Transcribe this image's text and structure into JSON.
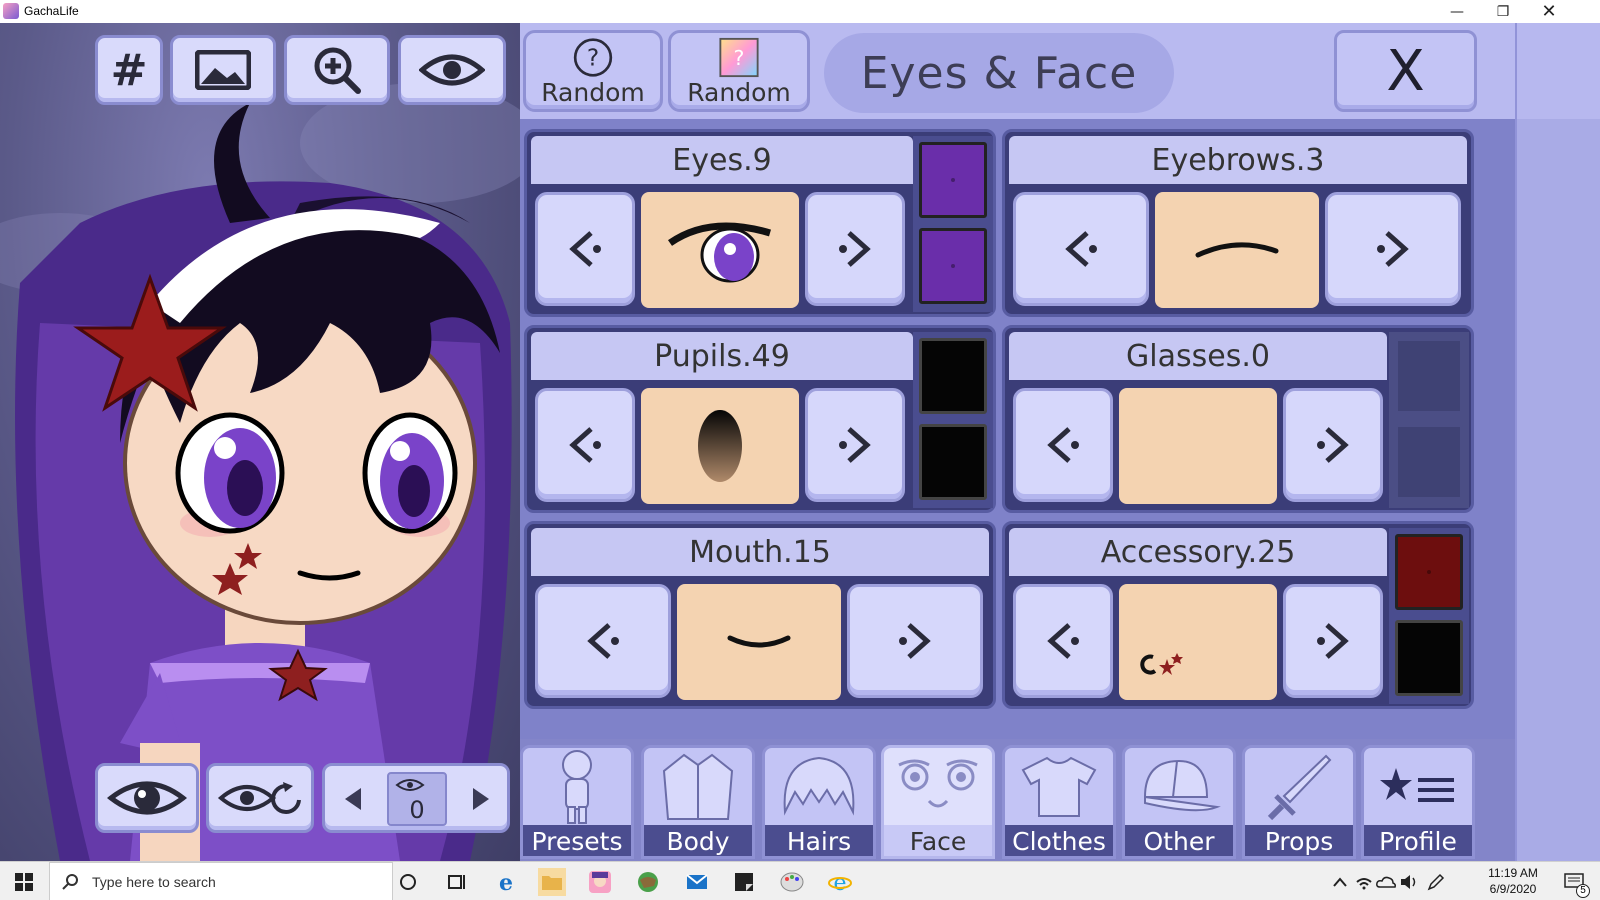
{
  "window": {
    "title": "GachaLife"
  },
  "toolbar": {
    "hash_label": "#"
  },
  "preview_controls": {
    "layer_value": "0"
  },
  "header": {
    "random1_label": "Random",
    "random2_label": "Random",
    "title": "Eyes & Face",
    "close_label": "X"
  },
  "cells": {
    "eyes": {
      "label": "Eyes.9",
      "colors": [
        "#6a2eaa",
        "#6a2eaa"
      ]
    },
    "eyebrows": {
      "label": "Eyebrows.3"
    },
    "pupils": {
      "label": "Pupils.49",
      "colors": [
        "#050505",
        "#050505"
      ]
    },
    "glasses": {
      "label": "Glasses.0"
    },
    "mouth": {
      "label": "Mouth.15"
    },
    "accessory": {
      "label": "Accessory.25",
      "colors": [
        "#6d0e0e",
        "#050505"
      ]
    }
  },
  "tabs": [
    {
      "label": "Presets",
      "icon": "person-icon"
    },
    {
      "label": "Body",
      "icon": "jacket-icon"
    },
    {
      "label": "Hairs",
      "icon": "hair-icon"
    },
    {
      "label": "Face",
      "icon": "face-icon"
    },
    {
      "label": "Clothes",
      "icon": "shirt-icon"
    },
    {
      "label": "Other",
      "icon": "cap-icon"
    },
    {
      "label": "Props",
      "icon": "sword-icon"
    },
    {
      "label": "Profile",
      "icon": "star-list-icon"
    }
  ],
  "taskbar": {
    "search_placeholder": "Type here to search",
    "time": "11:19 AM",
    "date": "6/9/2020",
    "notification_count": "5"
  },
  "colors": {
    "panel_dark": "#3b3d78",
    "panel_light": "#c3c4f5",
    "skin": "#f4d3b1"
  }
}
